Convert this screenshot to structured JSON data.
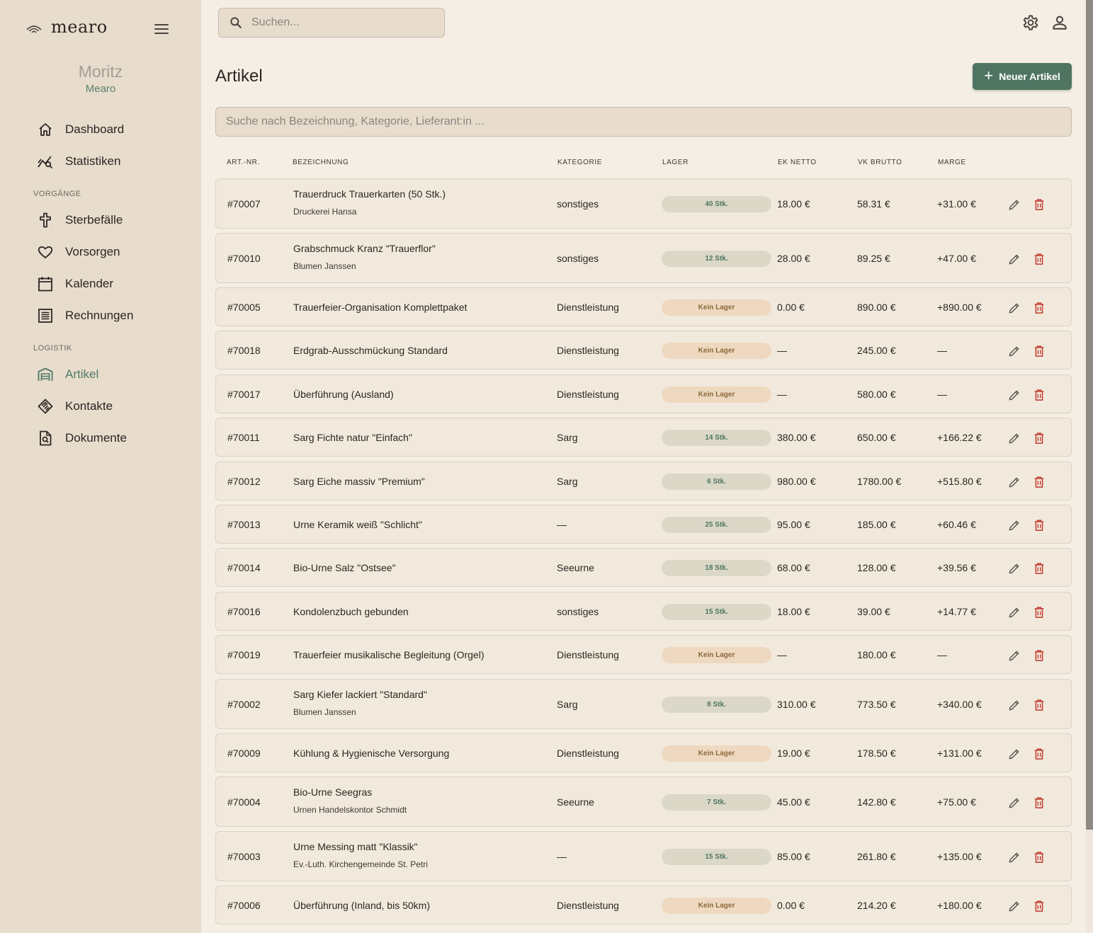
{
  "app": {
    "name": "mearo"
  },
  "user": {
    "name": "Moritz",
    "org": "Mearo"
  },
  "nav": {
    "main": [
      {
        "label": "Dashboard",
        "icon": "home-icon"
      },
      {
        "label": "Statistiken",
        "icon": "stats-icon"
      }
    ],
    "section_vorgaenge": "VORGÄNGE",
    "vorgaenge": [
      {
        "label": "Sterbefälle",
        "icon": "cross-icon"
      },
      {
        "label": "Vorsorgen",
        "icon": "heart-icon"
      },
      {
        "label": "Kalender",
        "icon": "calendar-icon"
      },
      {
        "label": "Rechnungen",
        "icon": "invoice-icon"
      }
    ],
    "section_logistik": "LOGISTIK",
    "logistik": [
      {
        "label": "Artikel",
        "icon": "warehouse-icon",
        "active": true
      },
      {
        "label": "Kontakte",
        "icon": "handshake-icon"
      },
      {
        "label": "Dokumente",
        "icon": "document-search-icon"
      }
    ]
  },
  "search": {
    "placeholder": "Suchen..."
  },
  "page": {
    "title": "Artikel",
    "new_button": "Neuer Artikel",
    "filter_placeholder": "Suche nach Bezeichnung, Kategorie, Lieferant:in ..."
  },
  "table": {
    "headers": {
      "nr": "ART.-NR.",
      "name": "BEZEICHNUNG",
      "cat": "KATEGORIE",
      "stock": "LAGER",
      "ek": "EK NETTO",
      "vk": "VK BRUTTO",
      "margin": "MARGE"
    },
    "rows": [
      {
        "nr": "#70007",
        "name": "Trauerdruck Trauerkarten (50 Stk.)",
        "supplier": "Druckerei Hansa",
        "cat": "sonstiges",
        "stock": "40 Stk.",
        "stock_type": "stock",
        "ek": "18.00 €",
        "vk": "58.31 €",
        "margin": "+31.00 €"
      },
      {
        "nr": "#70010",
        "name": "Grabschmuck Kranz \"Trauerflor\"",
        "supplier": "Blumen Janssen",
        "cat": "sonstiges",
        "stock": "12 Stk.",
        "stock_type": "stock",
        "ek": "28.00 €",
        "vk": "89.25 €",
        "margin": "+47.00 €"
      },
      {
        "nr": "#70005",
        "name": "Trauerfeier-Organisation Komplettpaket",
        "supplier": "",
        "cat": "Dienstleistung",
        "stock": "Kein Lager",
        "stock_type": "none",
        "ek": "0.00 €",
        "vk": "890.00 €",
        "margin": "+890.00 €"
      },
      {
        "nr": "#70018",
        "name": "Erdgrab-Ausschmückung Standard",
        "supplier": "",
        "cat": "Dienstleistung",
        "stock": "Kein Lager",
        "stock_type": "none",
        "ek": "—",
        "vk": "245.00 €",
        "margin": "—"
      },
      {
        "nr": "#70017",
        "name": "Überführung (Ausland)",
        "supplier": "",
        "cat": "Dienstleistung",
        "stock": "Kein Lager",
        "stock_type": "none",
        "ek": "—",
        "vk": "580.00 €",
        "margin": "—"
      },
      {
        "nr": "#70011",
        "name": "Sarg Fichte natur \"Einfach\"",
        "supplier": "",
        "cat": "Sarg",
        "stock": "14 Stk.",
        "stock_type": "stock",
        "ek": "380.00 €",
        "vk": "650.00 €",
        "margin": "+166.22 €"
      },
      {
        "nr": "#70012",
        "name": "Sarg Eiche massiv \"Premium\"",
        "supplier": "",
        "cat": "Sarg",
        "stock": "6 Stk.",
        "stock_type": "stock",
        "ek": "980.00 €",
        "vk": "1780.00 €",
        "margin": "+515.80 €"
      },
      {
        "nr": "#70013",
        "name": "Urne Keramik weiß \"Schlicht\"",
        "supplier": "",
        "cat": "—",
        "stock": "25 Stk.",
        "stock_type": "stock",
        "ek": "95.00 €",
        "vk": "185.00 €",
        "margin": "+60.46 €"
      },
      {
        "nr": "#70014",
        "name": "Bio-Urne Salz \"Ostsee\"",
        "supplier": "",
        "cat": "Seeurne",
        "stock": "18 Stk.",
        "stock_type": "stock",
        "ek": "68.00 €",
        "vk": "128.00 €",
        "margin": "+39.56 €"
      },
      {
        "nr": "#70016",
        "name": "Kondolenzbuch gebunden",
        "supplier": "",
        "cat": "sonstiges",
        "stock": "15 Stk.",
        "stock_type": "stock",
        "ek": "18.00 €",
        "vk": "39.00 €",
        "margin": "+14.77 €"
      },
      {
        "nr": "#70019",
        "name": "Trauerfeier musikalische Begleitung (Orgel)",
        "supplier": "",
        "cat": "Dienstleistung",
        "stock": "Kein Lager",
        "stock_type": "none",
        "ek": "—",
        "vk": "180.00 €",
        "margin": "—"
      },
      {
        "nr": "#70002",
        "name": "Sarg Kiefer lackiert \"Standard\"",
        "supplier": "Blumen Janssen",
        "cat": "Sarg",
        "stock": "8 Stk.",
        "stock_type": "stock",
        "ek": "310.00 €",
        "vk": "773.50 €",
        "margin": "+340.00 €"
      },
      {
        "nr": "#70009",
        "name": "Kühlung & Hygienische Versorgung",
        "supplier": "",
        "cat": "Dienstleistung",
        "stock": "Kein Lager",
        "stock_type": "none",
        "ek": "19.00 €",
        "vk": "178.50 €",
        "margin": "+131.00 €"
      },
      {
        "nr": "#70004",
        "name": "Bio-Urne Seegras",
        "supplier": "Urnen Handelskontor Schmidt",
        "cat": "Seeurne",
        "stock": "7 Stk.",
        "stock_type": "stock",
        "ek": "45.00 €",
        "vk": "142.80 €",
        "margin": "+75.00 €"
      },
      {
        "nr": "#70003",
        "name": "Urne Messing matt \"Klassik\"",
        "supplier": "Ev.-Luth. Kirchengemeinde St. Petri",
        "cat": "—",
        "stock": "15 Stk.",
        "stock_type": "stock",
        "ek": "85.00 €",
        "vk": "261.80 €",
        "margin": "+135.00 €"
      },
      {
        "nr": "#70006",
        "name": "Überführung (Inland, bis 50km)",
        "supplier": "",
        "cat": "Dienstleistung",
        "stock": "Kein Lager",
        "stock_type": "none",
        "ek": "0.00 €",
        "vk": "214.20 €",
        "margin": "+180.00 €"
      }
    ]
  },
  "colors": {
    "accent": "#4f7562",
    "sidebar_bg": "#e8dccd",
    "page_bg": "#f5eee4",
    "delete": "#c0392b"
  }
}
